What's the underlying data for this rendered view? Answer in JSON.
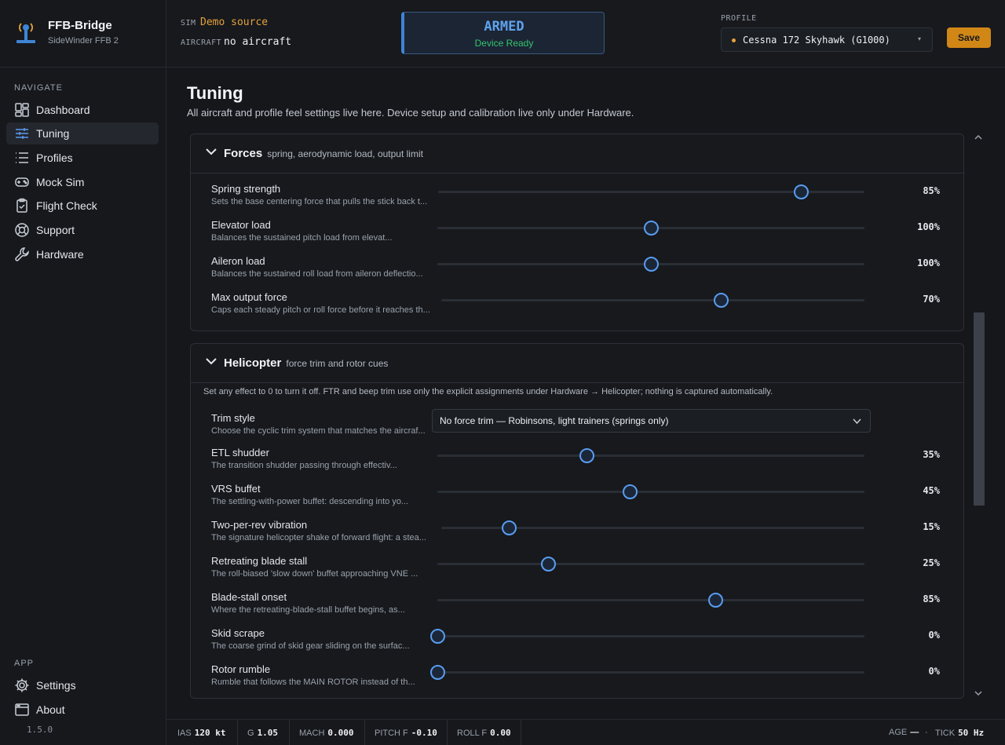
{
  "brand": {
    "name": "FFB-Bridge",
    "subtitle": "SideWinder FFB 2",
    "version": "1.5.0"
  },
  "nav": {
    "navigate_heading": "NAVIGATE",
    "app_heading": "APP",
    "items": [
      {
        "label": "Dashboard",
        "icon": "dashboard-icon"
      },
      {
        "label": "Tuning",
        "icon": "sliders-icon",
        "active": true
      },
      {
        "label": "Profiles",
        "icon": "list-icon"
      },
      {
        "label": "Mock Sim",
        "icon": "gamepad-icon"
      },
      {
        "label": "Flight Check",
        "icon": "clipboard-check-icon"
      },
      {
        "label": "Support",
        "icon": "lifebuoy-icon"
      },
      {
        "label": "Hardware",
        "icon": "wrench-icon"
      }
    ],
    "app_items": [
      {
        "label": "Settings",
        "icon": "gear-icon"
      },
      {
        "label": "About",
        "icon": "window-icon"
      }
    ]
  },
  "header": {
    "sim_label": "SIM",
    "sim_value": "Demo source",
    "aircraft_label": "AIRCRAFT",
    "aircraft_value": "no aircraft",
    "status_title": "ARMED",
    "status_sub": "Device Ready",
    "profile_label": "PROFILE",
    "profile_value": "Cessna 172 Skyhawk (G1000)",
    "save_label": "Save"
  },
  "colors": {
    "accent": "#5a9cf0",
    "armed": "#5fa2ee",
    "ready": "#35c46e",
    "save": "#d18716",
    "sim_value": "#e5a23a"
  },
  "page": {
    "title": "Tuning",
    "subtitle": "All aircraft and profile feel settings live here. Device setup and calibration live only under Hardware."
  },
  "forces": {
    "title": "Forces",
    "subtitle": "spring, aerodynamic load, output limit",
    "rows": [
      {
        "name": "Spring strength",
        "desc": "Sets the base centering force that pulls the stick back t...",
        "value": "85%",
        "level": 0.85
      },
      {
        "name": "Elevator load",
        "desc": "Balances the sustained pitch load from elevat...",
        "value": "100%",
        "level": 0.5
      },
      {
        "name": "Aileron load",
        "desc": "Balances the sustained roll load from aileron deflectio...",
        "value": "100%",
        "level": 0.5
      },
      {
        "name": "Max output force",
        "desc": "Caps each steady pitch or roll force before it reaches th...",
        "value": "70%",
        "level": 0.66
      }
    ]
  },
  "helicopter": {
    "title": "Helicopter",
    "subtitle": "force trim and rotor cues",
    "note": "Set any effect to 0 to turn it off. FTR and beep trim use only the explicit assignments under Hardware → Helicopter; nothing is captured automatically.",
    "trim_style": {
      "name": "Trim style",
      "desc": "Choose the cyclic trim system that matches the aircraf...",
      "value": "No force trim — Robinsons, light trainers (springs only)"
    },
    "rows": [
      {
        "name": "ETL shudder",
        "desc": "The transition shudder passing through effectiv...",
        "value": "35%",
        "level": 0.35
      },
      {
        "name": "VRS buffet",
        "desc": "The settling-with-power buffet: descending into yo...",
        "value": "45%",
        "level": 0.45
      },
      {
        "name": "Two-per-rev vibration",
        "desc": "The signature helicopter shake of forward flight: a stea...",
        "value": "15%",
        "level": 0.16
      },
      {
        "name": "Retreating blade stall",
        "desc": "The roll-biased 'slow down' buffet approaching VNE ...",
        "value": "25%",
        "level": 0.26
      },
      {
        "name": "Blade-stall onset",
        "desc": "Where the retreating-blade-stall buffet begins, as...",
        "value": "85%",
        "level": 0.65
      },
      {
        "name": "Skid scrape",
        "desc": "The coarse grind of skid gear sliding on the surfac...",
        "value": "0%",
        "level": 0.0
      },
      {
        "name": "Rotor rumble",
        "desc": "Rumble that follows the MAIN ROTOR instead of th...",
        "value": "0%",
        "level": 0.0
      }
    ]
  },
  "status": {
    "ias_label": "IAS",
    "ias_value": "120 kt",
    "g_label": "G",
    "g_value": "1.05",
    "mach_label": "MACH",
    "mach_value": "0.000",
    "pitch_label": "PITCH F",
    "pitch_value": "-0.10",
    "roll_label": "ROLL F",
    "roll_value": "0.00",
    "age_label": "AGE",
    "age_value": "—",
    "tick_label": "TICK",
    "tick_value": "50 Hz"
  }
}
